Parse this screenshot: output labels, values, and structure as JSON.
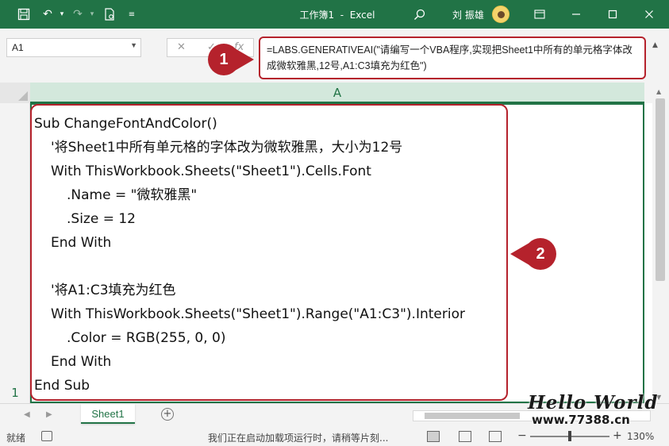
{
  "titlebar": {
    "title": "工作簿1  -  Excel",
    "user": "刘 振雄",
    "icons": {
      "save": "save-icon",
      "undo": "undo-icon",
      "redo": "redo-icon",
      "print_preview": "print-preview-icon",
      "customize": "customize-quick-access-icon",
      "search": "search-icon",
      "ribbon_display": "ribbon-display-options-icon",
      "minimize": "minimize-icon",
      "maximize": "maximize-icon",
      "close": "close-icon"
    }
  },
  "formula_bar": {
    "name_box": "A1",
    "formula": "=LABS.GENERATIVEAI(\"请编写一个VBA程序,实现把Sheet1中所有的单元格字体改成微软雅黑,12号,A1:C3填充为红色\")"
  },
  "grid": {
    "column_header": "A",
    "row_number": "1",
    "cell_code": [
      "Sub ChangeFontAndColor()",
      "'将Sheet1中所有单元格的字体改为微软雅黑，大小为12号",
      "With ThisWorkbook.Sheets(\"Sheet1\").Cells.Font",
      ".Name = \"微软雅黑\"",
      ".Size = 12",
      "End With",
      "",
      "'将A1:C3填充为红色",
      "With ThisWorkbook.Sheets(\"Sheet1\").Range(\"A1:C3\").Interior",
      ".Color = RGB(255, 0, 0)",
      "End With",
      "End Sub"
    ]
  },
  "callouts": {
    "one": "1",
    "two": "2",
    "color": "#b5222c"
  },
  "sheet_tabs": {
    "active": "Sheet1"
  },
  "watermark": {
    "line1": "Hello World",
    "line2": "www.77388.cn"
  },
  "statusbar": {
    "ready": "就绪",
    "message": "我们正在启动加载项运行时，请稍等片刻...",
    "zoom": "130%"
  },
  "colors": {
    "excel_green": "#217346",
    "annotation_red": "#b5222c"
  }
}
